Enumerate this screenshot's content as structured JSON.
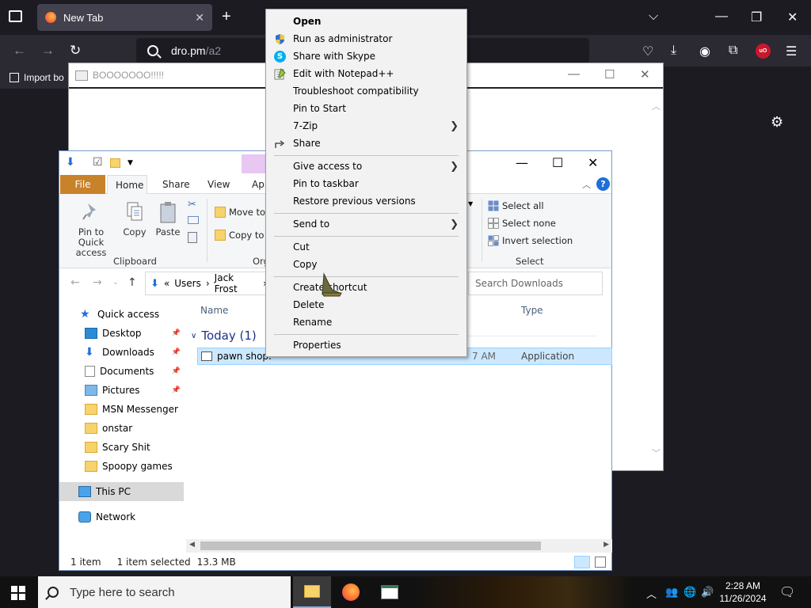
{
  "browser": {
    "tab_title": "New Tab",
    "url_host": "dro.pm",
    "url_path": "/a2",
    "bookmark_label": "Import bo"
  },
  "popup": {
    "title": "BOOOOOOO!!!!!"
  },
  "explorer": {
    "ribbon_tabs": {
      "file": "File",
      "home": "Home",
      "share": "Share",
      "view": "View",
      "app": "App"
    },
    "clipboard": {
      "pin": "Pin to Quick access",
      "copy": "Copy",
      "paste": "Paste",
      "group": "Clipboard"
    },
    "organize": {
      "move_to": "Move to",
      "copy_to": "Copy to",
      "group": "Org"
    },
    "select": {
      "select_all": "Select all",
      "select_none": "Select none",
      "invert": "Invert selection",
      "group": "Select"
    },
    "breadcrumb": [
      "«",
      "Users",
      "›",
      "Jack Frost",
      "›"
    ],
    "search_placeholder": "Search Downloads",
    "tree": [
      {
        "label": "Quick access",
        "pinned": false
      },
      {
        "label": "Desktop",
        "pinned": true
      },
      {
        "label": "Downloads",
        "pinned": true
      },
      {
        "label": "Documents",
        "pinned": true
      },
      {
        "label": "Pictures",
        "pinned": true
      },
      {
        "label": "MSN Messenger",
        "pinned": false
      },
      {
        "label": "onstar",
        "pinned": false
      },
      {
        "label": "Scary Shit",
        "pinned": false
      },
      {
        "label": "Spoopy games",
        "pinned": false
      },
      {
        "label": "This PC",
        "pinned": false
      },
      {
        "label": "Network",
        "pinned": false
      }
    ],
    "columns": {
      "name": "Name",
      "type": "Type"
    },
    "group_label": "Today (1)",
    "file": {
      "name": "pawn shop.",
      "time": "7 AM",
      "type": "Application"
    },
    "status": {
      "items": "1 item",
      "selected": "1 item selected",
      "size": "13.3 MB"
    }
  },
  "context_menu": {
    "items": [
      {
        "label": "Open",
        "bold": true,
        "icon": "",
        "submenu": false
      },
      {
        "label": "Run as administrator",
        "bold": false,
        "icon": "shield-icon",
        "submenu": false
      },
      {
        "label": "Share with Skype",
        "bold": false,
        "icon": "skype-icon",
        "submenu": false
      },
      {
        "label": "Edit with Notepad++",
        "bold": false,
        "icon": "notepad-icon",
        "submenu": false
      },
      {
        "label": "Troubleshoot compatibility",
        "bold": false,
        "icon": "",
        "submenu": false
      },
      {
        "label": "Pin to Start",
        "bold": false,
        "icon": "",
        "submenu": false
      },
      {
        "label": "7-Zip",
        "bold": false,
        "icon": "",
        "submenu": true
      },
      {
        "label": "Share",
        "bold": false,
        "icon": "share-icon",
        "submenu": false
      },
      {
        "label": "Give access to",
        "bold": false,
        "icon": "",
        "submenu": true
      },
      {
        "label": "Pin to taskbar",
        "bold": false,
        "icon": "",
        "submenu": false
      },
      {
        "label": "Restore previous versions",
        "bold": false,
        "icon": "",
        "submenu": false
      },
      {
        "label": "Send to",
        "bold": false,
        "icon": "",
        "submenu": true
      },
      {
        "label": "Cut",
        "bold": false,
        "icon": "",
        "submenu": false
      },
      {
        "label": "Copy",
        "bold": false,
        "icon": "",
        "submenu": false
      },
      {
        "label": "Create shortcut",
        "bold": false,
        "icon": "",
        "submenu": false
      },
      {
        "label": "Delete",
        "bold": false,
        "icon": "",
        "submenu": false
      },
      {
        "label": "Rename",
        "bold": false,
        "icon": "",
        "submenu": false
      },
      {
        "label": "Properties",
        "bold": false,
        "icon": "",
        "submenu": false
      }
    ]
  },
  "taskbar": {
    "search_placeholder": "Type here to search",
    "time": "2:28 AM",
    "date": "11/26/2024"
  },
  "colors": {
    "file_tab": "#c8822a",
    "selection": "#cce8ff",
    "firefox_dark": "#1c1b22",
    "toolbar": "#2b2a33"
  }
}
